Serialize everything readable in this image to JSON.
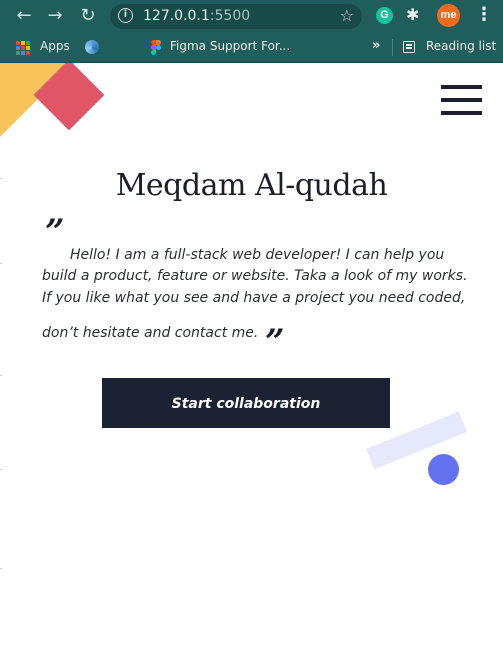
{
  "browser": {
    "url_host": "127.0.0.1",
    "url_port": ":5500",
    "profile_initials": "me",
    "extension_letter": "G",
    "icons": {
      "back": "arrow-left-icon",
      "forward": "arrow-right-icon",
      "reload": "reload-icon",
      "info": "info-icon",
      "star": "star-icon",
      "extensions": "puzzle-icon",
      "menu": "kebab-menu-icon"
    },
    "bookmarks": {
      "apps_label": "Apps",
      "figma_label": "Figma Support For...",
      "overflow_label": "»",
      "reading_list_label": "Reading list"
    }
  },
  "page": {
    "colors": {
      "accent_yellow": "#f7c35a",
      "accent_red": "#e05666",
      "dark": "#1b2232",
      "accent_blue": "#6472f2",
      "accent_blue_light": "#e6e8fb"
    },
    "hero": {
      "name": "Meqdam Al-qudah",
      "quote_open": "”",
      "quote_close": "”",
      "bio_lines": [
        "Hello! I am a full-stack web developer! I can help you",
        "build a product, feature or website. Taka a look of my works.",
        "If you like what you see and have a project you need coded,",
        "don’t hesitate and contact me."
      ],
      "cta_label": "Start collaboration"
    }
  }
}
